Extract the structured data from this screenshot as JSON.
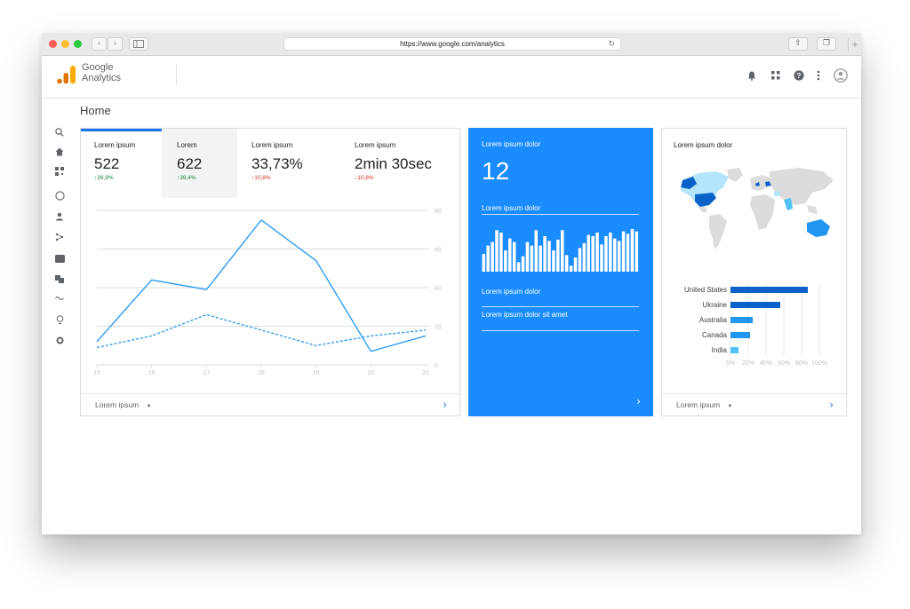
{
  "browser": {
    "url": "https://www.google.com/analytics"
  },
  "app": {
    "brand_line1": "Google",
    "brand_line2": "Analytics"
  },
  "page": {
    "title": "Home"
  },
  "metrics": [
    {
      "label": "Lorem ipsum",
      "value": "522",
      "change": "↑26,9%",
      "trend": "up"
    },
    {
      "label": "Lorem",
      "value": "622",
      "change": "↑39,4%",
      "trend": "up"
    },
    {
      "label": "Lorem ipsum",
      "value": "33,73%",
      "change": "↑10,8%",
      "trend": "down"
    },
    {
      "label": "Lorem ipsum",
      "value": "2min 30sec",
      "change": "↓10,8%",
      "trend": "down"
    }
  ],
  "main_card": {
    "footer_label": "Lorem ipsum"
  },
  "blue_card": {
    "title": "Lorem ipsum dolor",
    "big_number": "12",
    "subtitle": "Lorem ipsum dolor",
    "item1": "Lorem ipsum dolor",
    "item2": "Lorem ipsum dolor sit amet",
    "bar_values": [
      15,
      22,
      25,
      35,
      33,
      18,
      28,
      25,
      8,
      13,
      25,
      22,
      35,
      22,
      30,
      26,
      18,
      27,
      35,
      14,
      5,
      12,
      20,
      24,
      31,
      30,
      33,
      23,
      30,
      33,
      28,
      26,
      34,
      32,
      36,
      34
    ]
  },
  "map_card": {
    "title": "Lorem ipsum dolor",
    "footer_label": "Lorem ipsum",
    "colors": {
      "dark": "#0a62c9",
      "medium": "#2196f3",
      "light": "#4fc3f7",
      "pale": "#b3e5fc",
      "land": "#dcdcdc"
    }
  },
  "colors": {
    "accent": "#1a73e8",
    "blue_card": "#1a8cff",
    "line": "#2196f3",
    "up": "#188038",
    "down": "#d93025"
  },
  "chart_data": [
    {
      "type": "line",
      "x": [
        15,
        16,
        17,
        18,
        19,
        20,
        21
      ],
      "series": [
        {
          "style": "solid",
          "values": [
            12,
            44,
            39,
            75,
            54,
            7,
            15
          ]
        },
        {
          "style": "dashed",
          "values": [
            9,
            15,
            26,
            18,
            10,
            15,
            18
          ]
        }
      ],
      "ylim": [
        0,
        80
      ],
      "yticks": [
        "0",
        "20",
        "40",
        "60",
        "80"
      ],
      "xticks": [
        "15",
        "16",
        "17",
        "18",
        "19",
        "20",
        "21"
      ],
      "grid": true
    },
    {
      "type": "bar",
      "orientation": "horizontal",
      "categories": [
        "United States",
        "Ukraine",
        "Australia",
        "Canada",
        "India"
      ],
      "values": [
        87,
        56,
        25,
        22,
        9
      ],
      "xlim": [
        0,
        100
      ],
      "xticks": [
        "0%",
        "20%",
        "40%",
        "60%",
        "80%",
        "100%"
      ]
    }
  ]
}
